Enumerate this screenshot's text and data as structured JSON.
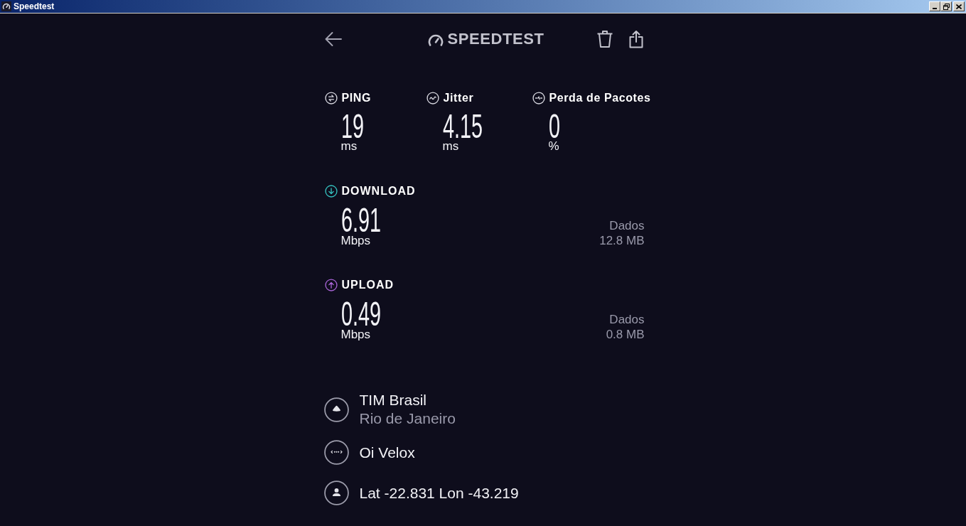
{
  "window": {
    "title": "Speedtest"
  },
  "header": {
    "logo": "SPEEDTEST"
  },
  "metrics": [
    {
      "kind": "ping",
      "label": "PING",
      "value": "19",
      "unit": "ms"
    },
    {
      "kind": "jitter",
      "label": "Jitter",
      "value": "4.15",
      "unit": "ms"
    },
    {
      "kind": "loss",
      "label": "Perda de Pacotes",
      "value": "0",
      "unit": "%"
    }
  ],
  "speeds": [
    {
      "kind": "download",
      "label": "DOWNLOAD",
      "color": "#35c2c0",
      "value": "6.91",
      "unit": "Mbps",
      "data_label": "Dados",
      "data_value": "12.8 MB"
    },
    {
      "kind": "upload",
      "label": "UPLOAD",
      "color": "#a864d6",
      "value": "0.49",
      "unit": "Mbps",
      "data_label": "Dados",
      "data_value": "0.8 MB"
    }
  ],
  "details": [
    {
      "kind": "server",
      "title": "TIM Brasil",
      "subtitle": "Rio de Janeiro"
    },
    {
      "kind": "provider",
      "title": "Oi Velox"
    },
    {
      "kind": "location",
      "title": "Lat -22.831 Lon -43.219"
    }
  ]
}
